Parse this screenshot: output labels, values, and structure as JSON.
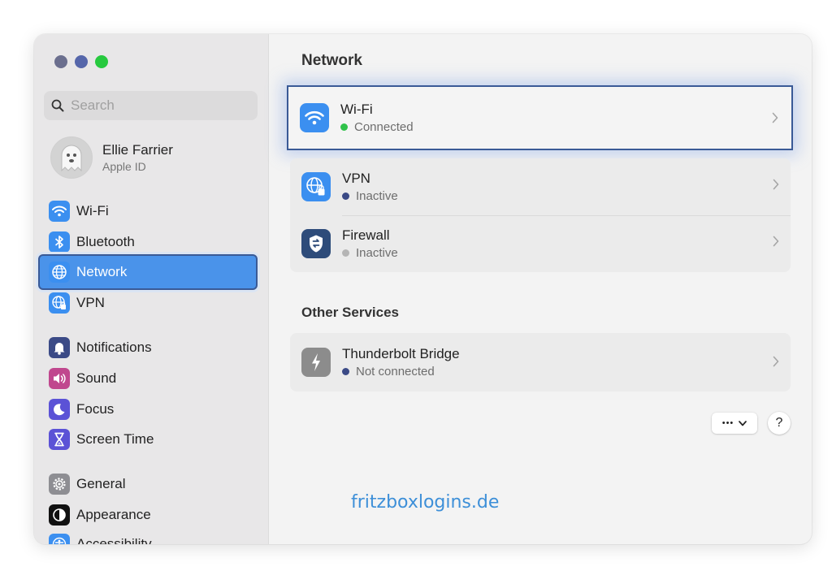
{
  "colors": {
    "accent": "#4a93ea",
    "traffic_close": "#6b6f8e",
    "traffic_minimize": "#5566aa",
    "traffic_zoom": "#27c93f",
    "status_connected": "#30c24a",
    "status_inactive": "#3b4a86",
    "status_disabled": "#b5b5b5"
  },
  "search": {
    "placeholder": "Search"
  },
  "user": {
    "name": "Ellie Farrier",
    "subtitle": "Apple ID"
  },
  "sidebar": {
    "items": [
      {
        "label": "Wi‑Fi",
        "icon": "wifi-icon"
      },
      {
        "label": "Bluetooth",
        "icon": "bluetooth-icon"
      },
      {
        "label": "Network",
        "icon": "globe-icon",
        "selected": true
      },
      {
        "label": "VPN",
        "icon": "vpn-icon"
      },
      {
        "label": "Notifications",
        "icon": "notifications-icon"
      },
      {
        "label": "Sound",
        "icon": "sound-icon"
      },
      {
        "label": "Focus",
        "icon": "moon-icon"
      },
      {
        "label": "Screen Time",
        "icon": "hourglass-icon"
      },
      {
        "label": "General",
        "icon": "gear-icon"
      },
      {
        "label": "Appearance",
        "icon": "appearance-icon"
      },
      {
        "label": "Accessibility",
        "icon": "accessibility-icon"
      }
    ]
  },
  "main": {
    "title": "Network",
    "services": [
      {
        "title": "Wi‑Fi",
        "status": "Connected",
        "icon": "wifi-icon"
      },
      {
        "title": "VPN",
        "status": "Inactive",
        "icon": "vpn-icon"
      },
      {
        "title": "Firewall",
        "status": "Inactive",
        "icon": "firewall-icon"
      }
    ],
    "other_services_title": "Other Services",
    "other_services": [
      {
        "title": "Thunderbolt Bridge",
        "status": "Not connected",
        "icon": "thunderbolt-icon"
      }
    ],
    "more_button_label": "•••",
    "help_button_label": "?"
  },
  "watermark": "fritzboxlogins.de"
}
